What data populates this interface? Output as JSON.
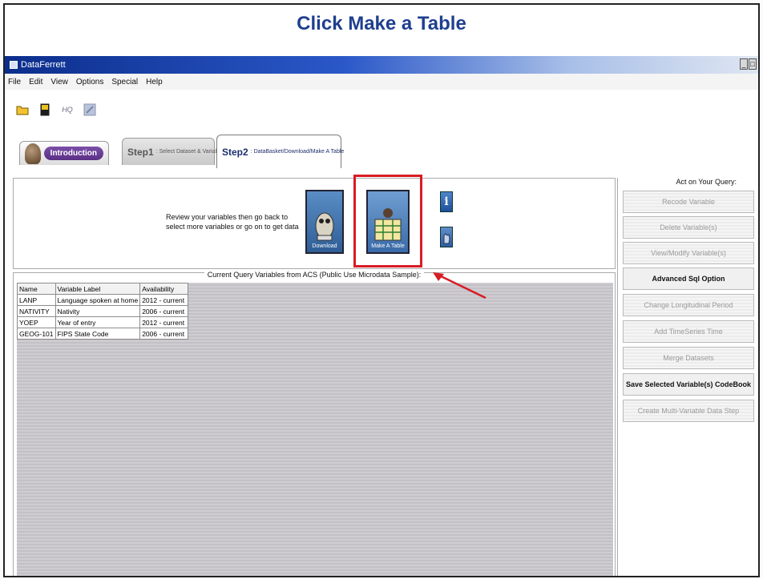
{
  "heading": "Click Make a Table",
  "window": {
    "title": "DataFerrett",
    "buttons": [
      "_",
      "□"
    ]
  },
  "menu": [
    "File",
    "Edit",
    "View",
    "Options",
    "Special",
    "Help"
  ],
  "toolbar": {
    "icons": [
      "open-folder-icon",
      "save-icon",
      "hq-icon",
      "disabled-tool-icon"
    ],
    "hq_label": "HQ"
  },
  "tabs": {
    "intro": "Introduction",
    "step1_big": "Step1",
    "step1_small": ": Select Dataset & Variable",
    "step2_big": "Step2",
    "step2_small": ": DataBasket/Download/Make A Table"
  },
  "top_panel": {
    "review_line1": "Review your variables then go back to",
    "review_line2": "select more variables or go on to get data",
    "download_label": "Download",
    "make_table_label": "Make A Table",
    "info_label": "i"
  },
  "query": {
    "title": "Current Query Variables from ACS  (Public Use Microdata Sample):",
    "columns": [
      "Name",
      "Variable Label",
      "Availability"
    ],
    "rows": [
      [
        "LANP",
        "Language spoken at home",
        "2012 -  current"
      ],
      [
        "NATIVITY",
        "Nativity",
        "2006 -  current"
      ],
      [
        "YOEP",
        "Year of entry",
        "2012 -  current"
      ],
      [
        "GEOG-101",
        "FIPS State Code",
        "2006 -  current"
      ]
    ]
  },
  "side": {
    "title": "Act on Your Query:",
    "buttons": [
      {
        "label": "Recode Variable",
        "enabled": false
      },
      {
        "label": "Delete Variable(s)",
        "enabled": false
      },
      {
        "label": "View/Modify Variable(s)",
        "enabled": false
      },
      {
        "label": "Advanced Sql Option",
        "enabled": true
      },
      {
        "label": "Change Longitudinal Period",
        "enabled": false
      },
      {
        "label": "Add TimeSeries Time",
        "enabled": false
      },
      {
        "label": "Merge Datasets",
        "enabled": false
      },
      {
        "label": "Save Selected Variable(s) CodeBook",
        "enabled": true
      },
      {
        "label": "Create Multi-Variable Data Step",
        "enabled": false
      }
    ]
  },
  "colors": {
    "heading": "#1f3f8f",
    "highlight": "#d81c24",
    "titlebar": "#0c2e8c"
  }
}
